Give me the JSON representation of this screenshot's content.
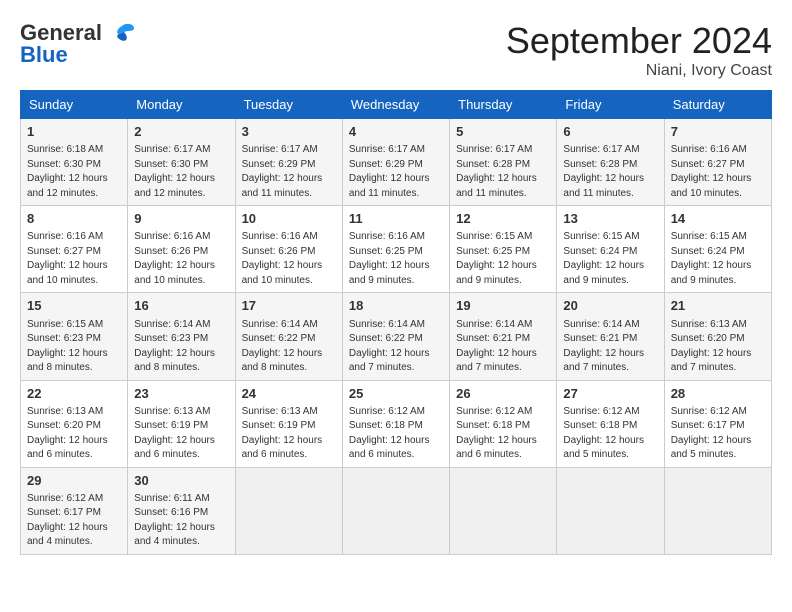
{
  "logo": {
    "line1": "General",
    "line2": "Blue"
  },
  "title": "September 2024",
  "location": "Niani, Ivory Coast",
  "days_of_week": [
    "Sunday",
    "Monday",
    "Tuesday",
    "Wednesday",
    "Thursday",
    "Friday",
    "Saturday"
  ],
  "weeks": [
    [
      {
        "day": "1",
        "info": "Sunrise: 6:18 AM\nSunset: 6:30 PM\nDaylight: 12 hours\nand 12 minutes."
      },
      {
        "day": "2",
        "info": "Sunrise: 6:17 AM\nSunset: 6:30 PM\nDaylight: 12 hours\nand 12 minutes."
      },
      {
        "day": "3",
        "info": "Sunrise: 6:17 AM\nSunset: 6:29 PM\nDaylight: 12 hours\nand 11 minutes."
      },
      {
        "day": "4",
        "info": "Sunrise: 6:17 AM\nSunset: 6:29 PM\nDaylight: 12 hours\nand 11 minutes."
      },
      {
        "day": "5",
        "info": "Sunrise: 6:17 AM\nSunset: 6:28 PM\nDaylight: 12 hours\nand 11 minutes."
      },
      {
        "day": "6",
        "info": "Sunrise: 6:17 AM\nSunset: 6:28 PM\nDaylight: 12 hours\nand 11 minutes."
      },
      {
        "day": "7",
        "info": "Sunrise: 6:16 AM\nSunset: 6:27 PM\nDaylight: 12 hours\nand 10 minutes."
      }
    ],
    [
      {
        "day": "8",
        "info": "Sunrise: 6:16 AM\nSunset: 6:27 PM\nDaylight: 12 hours\nand 10 minutes."
      },
      {
        "day": "9",
        "info": "Sunrise: 6:16 AM\nSunset: 6:26 PM\nDaylight: 12 hours\nand 10 minutes."
      },
      {
        "day": "10",
        "info": "Sunrise: 6:16 AM\nSunset: 6:26 PM\nDaylight: 12 hours\nand 10 minutes."
      },
      {
        "day": "11",
        "info": "Sunrise: 6:16 AM\nSunset: 6:25 PM\nDaylight: 12 hours\nand 9 minutes."
      },
      {
        "day": "12",
        "info": "Sunrise: 6:15 AM\nSunset: 6:25 PM\nDaylight: 12 hours\nand 9 minutes."
      },
      {
        "day": "13",
        "info": "Sunrise: 6:15 AM\nSunset: 6:24 PM\nDaylight: 12 hours\nand 9 minutes."
      },
      {
        "day": "14",
        "info": "Sunrise: 6:15 AM\nSunset: 6:24 PM\nDaylight: 12 hours\nand 9 minutes."
      }
    ],
    [
      {
        "day": "15",
        "info": "Sunrise: 6:15 AM\nSunset: 6:23 PM\nDaylight: 12 hours\nand 8 minutes."
      },
      {
        "day": "16",
        "info": "Sunrise: 6:14 AM\nSunset: 6:23 PM\nDaylight: 12 hours\nand 8 minutes."
      },
      {
        "day": "17",
        "info": "Sunrise: 6:14 AM\nSunset: 6:22 PM\nDaylight: 12 hours\nand 8 minutes."
      },
      {
        "day": "18",
        "info": "Sunrise: 6:14 AM\nSunset: 6:22 PM\nDaylight: 12 hours\nand 7 minutes."
      },
      {
        "day": "19",
        "info": "Sunrise: 6:14 AM\nSunset: 6:21 PM\nDaylight: 12 hours\nand 7 minutes."
      },
      {
        "day": "20",
        "info": "Sunrise: 6:14 AM\nSunset: 6:21 PM\nDaylight: 12 hours\nand 7 minutes."
      },
      {
        "day": "21",
        "info": "Sunrise: 6:13 AM\nSunset: 6:20 PM\nDaylight: 12 hours\nand 7 minutes."
      }
    ],
    [
      {
        "day": "22",
        "info": "Sunrise: 6:13 AM\nSunset: 6:20 PM\nDaylight: 12 hours\nand 6 minutes."
      },
      {
        "day": "23",
        "info": "Sunrise: 6:13 AM\nSunset: 6:19 PM\nDaylight: 12 hours\nand 6 minutes."
      },
      {
        "day": "24",
        "info": "Sunrise: 6:13 AM\nSunset: 6:19 PM\nDaylight: 12 hours\nand 6 minutes."
      },
      {
        "day": "25",
        "info": "Sunrise: 6:12 AM\nSunset: 6:18 PM\nDaylight: 12 hours\nand 6 minutes."
      },
      {
        "day": "26",
        "info": "Sunrise: 6:12 AM\nSunset: 6:18 PM\nDaylight: 12 hours\nand 6 minutes."
      },
      {
        "day": "27",
        "info": "Sunrise: 6:12 AM\nSunset: 6:18 PM\nDaylight: 12 hours\nand 5 minutes."
      },
      {
        "day": "28",
        "info": "Sunrise: 6:12 AM\nSunset: 6:17 PM\nDaylight: 12 hours\nand 5 minutes."
      }
    ],
    [
      {
        "day": "29",
        "info": "Sunrise: 6:12 AM\nSunset: 6:17 PM\nDaylight: 12 hours\nand 4 minutes."
      },
      {
        "day": "30",
        "info": "Sunrise: 6:11 AM\nSunset: 6:16 PM\nDaylight: 12 hours\nand 4 minutes."
      },
      {
        "day": "",
        "info": ""
      },
      {
        "day": "",
        "info": ""
      },
      {
        "day": "",
        "info": ""
      },
      {
        "day": "",
        "info": ""
      },
      {
        "day": "",
        "info": ""
      }
    ]
  ]
}
